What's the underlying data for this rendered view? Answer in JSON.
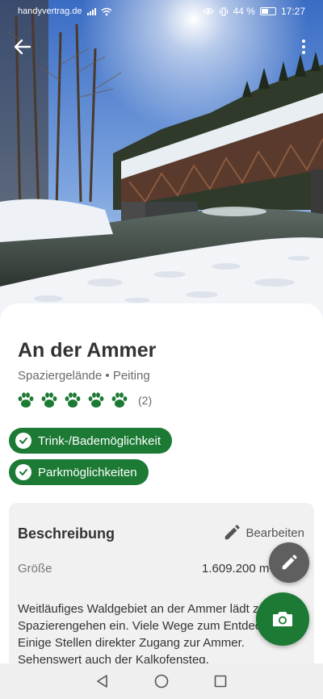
{
  "status_bar": {
    "carrier": "handyvertrag.de",
    "battery": "44 %",
    "time": "17:27"
  },
  "place": {
    "title": "An der Ammer",
    "subtitle": "Spaziergelände • Peiting",
    "rating": 5,
    "rating_count": "(2)"
  },
  "features": [
    {
      "label": "Trink-/Bademöglichkeit"
    },
    {
      "label": "Parkmöglichkeiten"
    }
  ],
  "description": {
    "heading": "Beschreibung",
    "edit_label": "Bearbeiten",
    "size_label": "Größe",
    "size_value": "1.609.200 m²",
    "text": "Weitläufiges Waldgebiet an der Ammer lädt zum Spazierengehen ein. Viele Wege zum Entdecken. Einige Stellen direkter Zugang zur Ammer. Sehenswert auch der Kalkofensteg,"
  },
  "colors": {
    "brand_green": "#1c7a34",
    "fab_grey": "#5f5f5f"
  }
}
